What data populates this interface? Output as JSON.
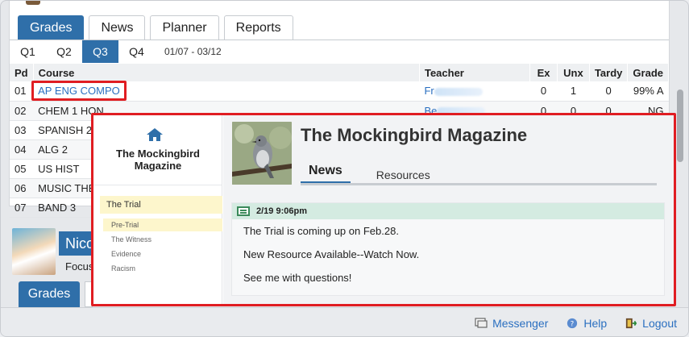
{
  "tabs": [
    "Grades",
    "News",
    "Planner",
    "Reports"
  ],
  "quarters": [
    "Q1",
    "Q2",
    "Q3",
    "Q4"
  ],
  "quarter_range": "01/07 - 03/12",
  "table": {
    "headers": [
      "Pd",
      "Course",
      "Teacher",
      "Ex",
      "Unx",
      "Tardy",
      "Grade"
    ],
    "rows": [
      {
        "pd": "01",
        "course": "AP ENG COMPO",
        "teacher": "Fr",
        "ex": "0",
        "unx": "1",
        "tardy": "0",
        "grade": "99% A"
      },
      {
        "pd": "02",
        "course": "CHEM 1 HON",
        "teacher": "Be",
        "ex": "0",
        "unx": "0",
        "tardy": "0",
        "grade": "NG"
      },
      {
        "pd": "03",
        "course": "SPANISH 2",
        "teacher": "",
        "ex": "",
        "unx": "",
        "tardy": "",
        "grade": ""
      },
      {
        "pd": "04",
        "course": "ALG 2",
        "teacher": "",
        "ex": "",
        "unx": "",
        "tardy": "",
        "grade": ""
      },
      {
        "pd": "05",
        "course": "US HIST",
        "teacher": "",
        "ex": "",
        "unx": "",
        "tardy": "",
        "grade": ""
      },
      {
        "pd": "06",
        "course": "MUSIC THE",
        "teacher": "",
        "ex": "",
        "unx": "",
        "tardy": "",
        "grade": ""
      },
      {
        "pd": "07",
        "course": "BAND 3",
        "teacher": "",
        "ex": "",
        "unx": "",
        "tardy": "",
        "grade": ""
      }
    ]
  },
  "student": {
    "name": "Nico",
    "focus": "Focus"
  },
  "lower_tab": "Grades",
  "footer": {
    "messenger": "Messenger",
    "help": "Help",
    "logout": "Logout"
  },
  "popup": {
    "side_title": "The Mockingbird Magazine",
    "section": "The Trial",
    "subitems": [
      "Pre-Trial",
      "The Witness",
      "Evidence",
      "Racism"
    ],
    "title": "The Mockingbird Magazine",
    "nav": [
      "News",
      "Resources"
    ],
    "post": {
      "date": "2/19 9:06pm",
      "lines": [
        "The Trial is coming up on Feb.28.",
        "New Resource Available--Watch Now.",
        "See me with questions!"
      ]
    }
  }
}
